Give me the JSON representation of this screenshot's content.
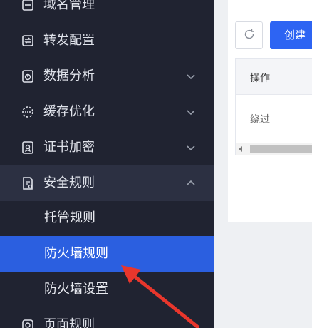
{
  "sidebar": {
    "items": [
      {
        "label": "域名管理",
        "icon": "domain-icon"
      },
      {
        "label": "转发配置",
        "icon": "forward-icon"
      },
      {
        "label": "数据分析",
        "icon": "analytics-icon"
      },
      {
        "label": "缓存优化",
        "icon": "cache-icon"
      },
      {
        "label": "证书加密",
        "icon": "certificate-icon"
      },
      {
        "label": "安全规则",
        "icon": "security-doc-icon"
      }
    ],
    "submenu": [
      {
        "label": "托管规则",
        "active": false
      },
      {
        "label": "防火墙规则",
        "active": true
      },
      {
        "label": "防火墙设置",
        "active": false
      }
    ],
    "last_item": {
      "label": "页面规则",
      "icon": "page-rule-icon"
    }
  },
  "main": {
    "create_button_label": "创建",
    "refresh_icon": "refresh-icon",
    "table": {
      "header": "操作",
      "rows": [
        "绕过"
      ]
    }
  },
  "colors": {
    "sidebar_bg": "#202331",
    "active_bg": "#2b5fe0",
    "primary": "#2d64f3",
    "annotation": "#e8362c"
  }
}
